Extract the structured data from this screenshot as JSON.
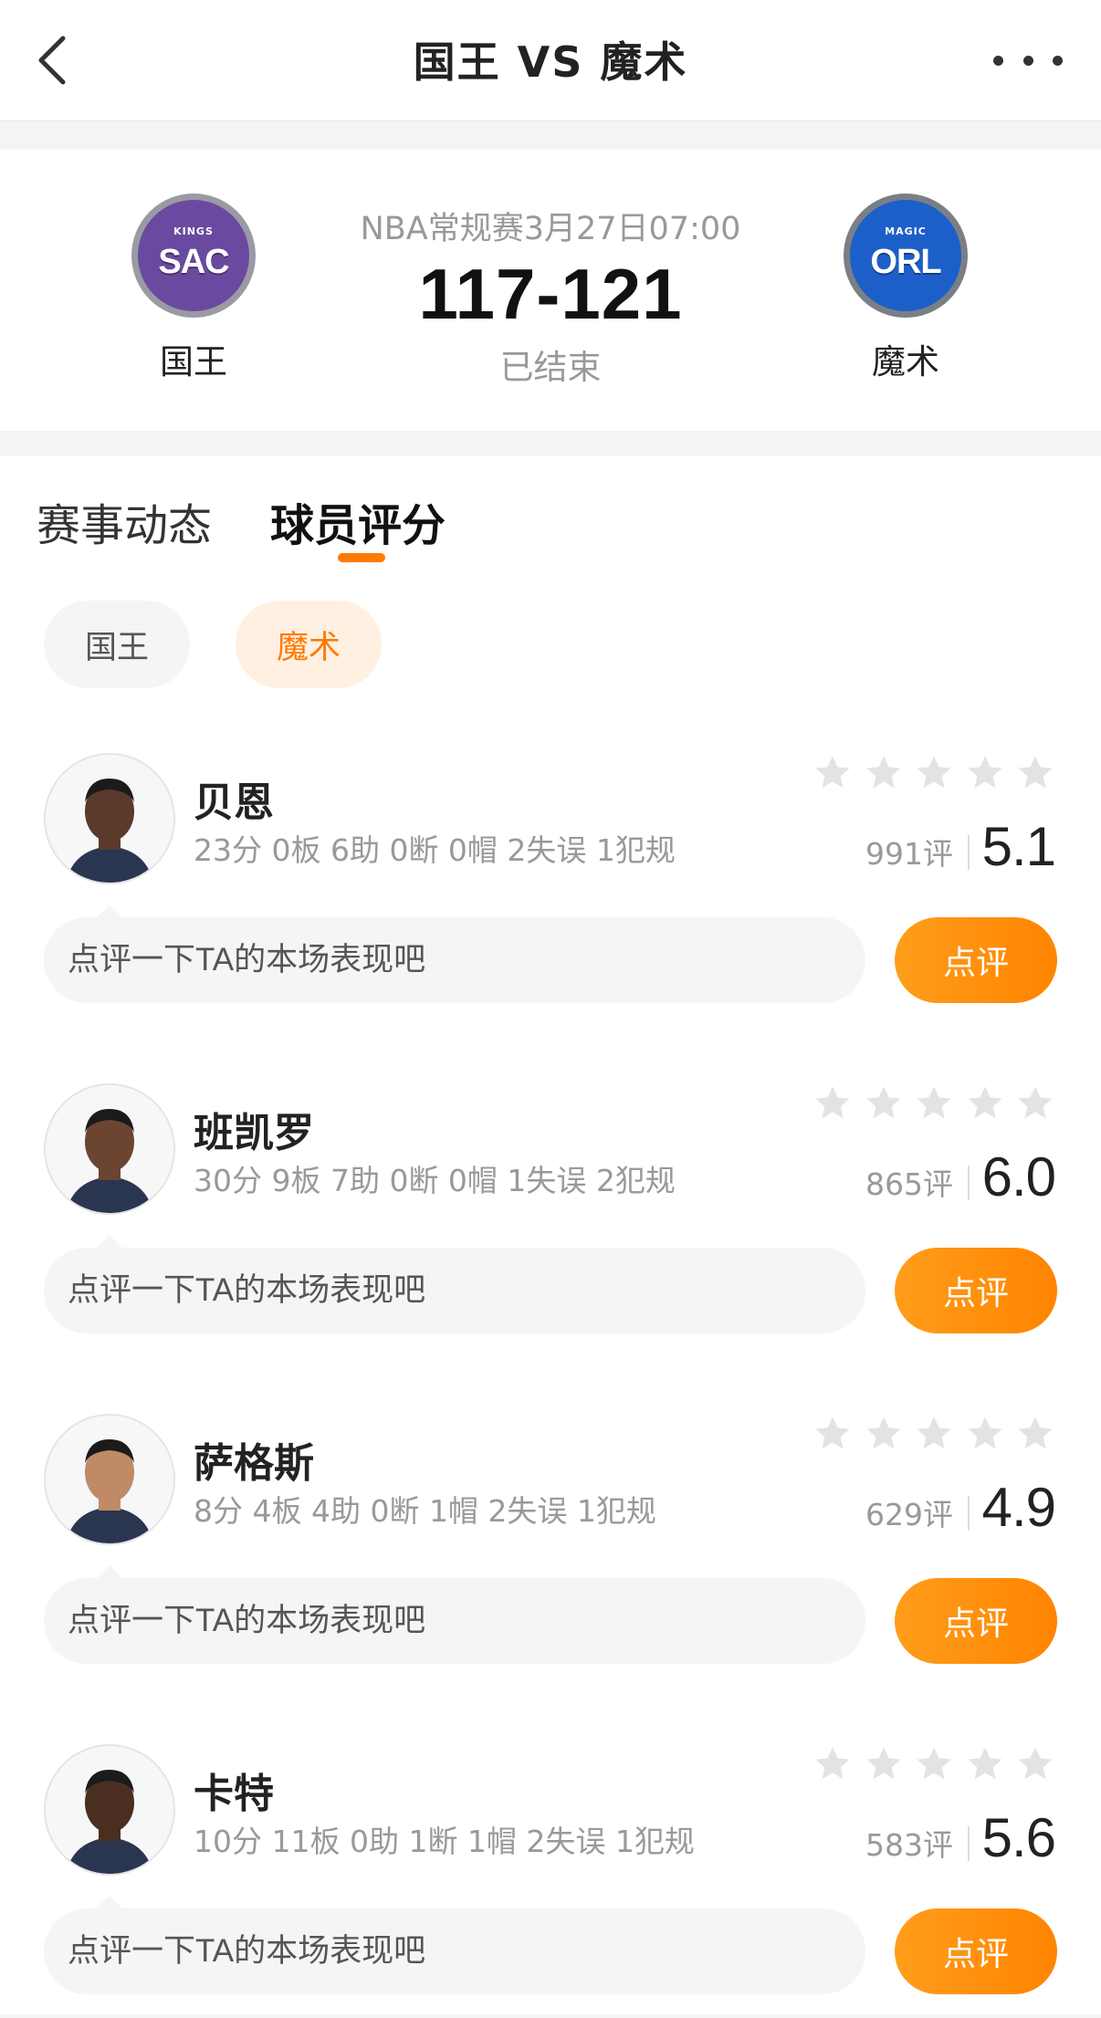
{
  "nav": {
    "title": "国王 VS 魔术",
    "back_icon": "chevron-left-icon",
    "more_icon": "more-horizontal-icon"
  },
  "match": {
    "home": {
      "name": "国王",
      "logo_abbr": "SAC",
      "logo_small": "KINGS",
      "color": "#6a4aa0"
    },
    "away": {
      "name": "魔术",
      "logo_abbr": "ORL",
      "logo_small": "MAGIC",
      "color": "#1d5fc9"
    },
    "meta": "NBA常规赛3月27日07:00",
    "score": "117-121",
    "status": "已结束"
  },
  "tabs": [
    {
      "label": "赛事动态",
      "active": false
    },
    {
      "label": "球员评分",
      "active": true
    }
  ],
  "team_filter": [
    {
      "label": "国王",
      "active": false
    },
    {
      "label": "魔术",
      "active": true
    }
  ],
  "accent_color": "#ff7a00",
  "players": [
    {
      "name": "贝恩",
      "stats": "23分 0板 6助 0断 0帽 2失误 1犯规",
      "count": "991评",
      "score": "5.1",
      "comment_placeholder": "点评一下TA的本场表现吧",
      "comment_button": "点评"
    },
    {
      "name": "班凯罗",
      "stats": "30分 9板 7助 0断 0帽 1失误 2犯规",
      "count": "865评",
      "score": "6.0",
      "comment_placeholder": "点评一下TA的本场表现吧",
      "comment_button": "点评"
    },
    {
      "name": "萨格斯",
      "stats": "8分 4板 4助 0断 1帽 2失误 1犯规",
      "count": "629评",
      "score": "4.9",
      "comment_placeholder": "点评一下TA的本场表现吧",
      "comment_button": "点评"
    },
    {
      "name": "卡特",
      "stats": "10分 11板 0助 1断 1帽 2失误 1犯规",
      "count": "583评",
      "score": "5.6",
      "comment_placeholder": "点评一下TA的本场表现吧",
      "comment_button": "点评"
    }
  ]
}
